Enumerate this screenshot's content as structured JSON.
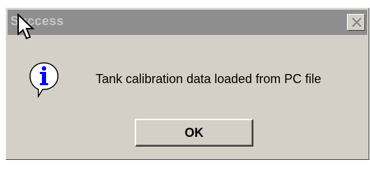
{
  "dialog": {
    "title": "Success",
    "message": "Tank calibration data loaded from PC file",
    "ok_label": "OK",
    "icons": {
      "info": "info-icon",
      "close": "close-icon",
      "cursor": "mouse-pointer-icon"
    },
    "colors": {
      "face": "#d4d0c8",
      "titlebar": "#8e8e8e",
      "title_text": "#c8c8c8",
      "info_blue": "#0000ff"
    }
  }
}
